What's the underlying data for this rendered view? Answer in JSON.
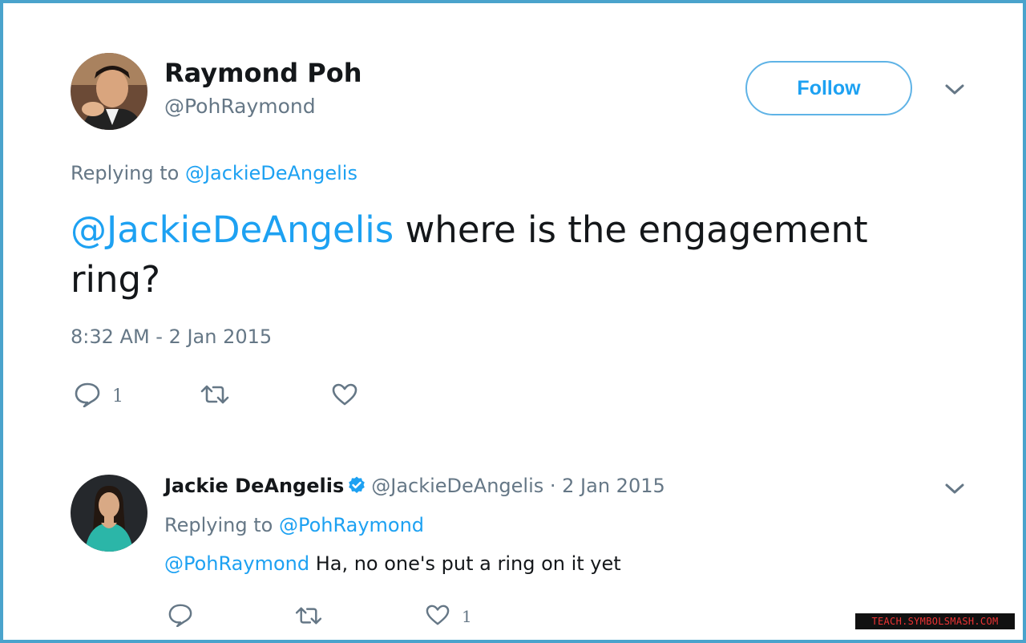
{
  "main_tweet": {
    "author": {
      "name": "Raymond Poh",
      "handle": "@PohRaymond"
    },
    "follow_label": "Follow",
    "replying_prefix": "Replying to",
    "replying_to": "@JackieDeAngelis",
    "text_mention": "@JackieDeAngelis",
    "text_body": " where is the engagement ring?",
    "timestamp": "8:32 AM - 2 Jan 2015",
    "actions": {
      "reply_count": "1",
      "retweet_count": "",
      "like_count": ""
    }
  },
  "reply_tweet": {
    "author": {
      "name": "Jackie DeAngelis",
      "verified": true,
      "handle": "@JackieDeAngelis",
      "date": " · 2 Jan 2015"
    },
    "replying_prefix": "Replying to",
    "replying_to": "@PohRaymond",
    "text_mention": "@PohRaymond",
    "text_body": " Ha, no one's put a ring on it yet",
    "actions": {
      "reply_count": "",
      "retweet_count": "",
      "like_count": "1"
    }
  },
  "watermark": "TEACH.SYMBOLSMASH.COM",
  "colors": {
    "accent": "#1da1f2",
    "muted": "#657786",
    "frame": "#4aa3cc"
  },
  "icons": [
    "reply-icon",
    "retweet-icon",
    "like-icon",
    "chevron-down-icon",
    "verified-badge-icon"
  ]
}
